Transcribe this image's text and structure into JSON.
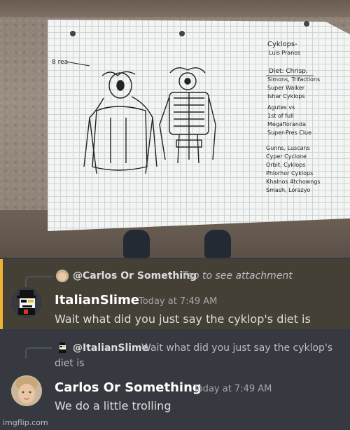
{
  "photo": {
    "notes_title": "Cyklops",
    "notes_lines": [
      "Cyklops-",
      "Luis Pranos",
      "Diet: Chrisp.",
      "Simons, Trifactions",
      "Super Walker",
      "Ishar Cyklops",
      "Agutes vs",
      "1st of full",
      "Megafloranda",
      "Super-Pres Clue",
      "Gunns, Luscans",
      "Cyper Cyclone",
      "Orbit, Cyklops",
      "Phlorhor Cyklops",
      "Khalnos 4tchowngs",
      "Smash, Lorazyo"
    ],
    "sketch_label": "8 rea"
  },
  "message1": {
    "reply_user": "@Carlos Or Something",
    "reply_text": "Tap to see attachment",
    "username": "ItalianSlime",
    "username_color": "#ffffff",
    "timestamp": "Today at 7:49 AM",
    "content": "Wait what did you just say the cyklop's diet is",
    "highlight_color": "#f0b232"
  },
  "message2": {
    "reply_user": "@ItalianSlime",
    "reply_text_line1": "Wait what did you just say the cyklop's",
    "reply_text_line2": "diet is",
    "username": "Carlos Or Something",
    "username_color": "#ffffff",
    "timestamp": "Today at 7:49 AM",
    "content": "We do a little trolling"
  },
  "watermark": "imgflip.com",
  "icons": {
    "reply_avatar_1": "carlos-avatar-icon",
    "avatar_1": "spamton-avatar-icon",
    "reply_avatar_2": "spamton-avatar-icon",
    "avatar_2": "carlos-avatar-icon"
  }
}
